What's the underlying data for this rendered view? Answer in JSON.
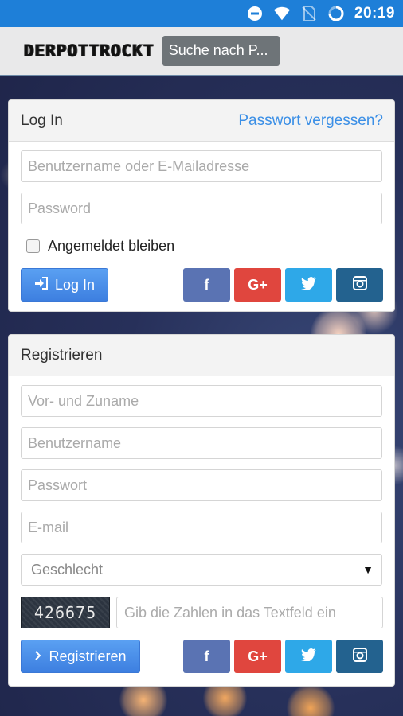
{
  "status_bar": {
    "time": "20:19",
    "icons": [
      "do-not-disturb-icon",
      "wifi-icon",
      "no-sim-icon",
      "loading-icon"
    ]
  },
  "app_bar": {
    "logo": "DERPOTTROCKT",
    "search_label": "Suche nach P..."
  },
  "login": {
    "title": "Log In",
    "forgot_link": "Passwort vergessen?",
    "username_placeholder": "Benutzername oder E-Mailadresse",
    "password_placeholder": "Password",
    "remember_label": "Angemeldet bleiben",
    "submit_label": "Log In",
    "submit_icon": "sign-in-icon"
  },
  "register": {
    "title": "Registrieren",
    "fullname_placeholder": "Vor- und Zuname",
    "username_placeholder": "Benutzername",
    "password_placeholder": "Passwort",
    "email_placeholder": "E-mail",
    "gender_selected": "Geschlecht",
    "captcha_code": "426675",
    "captcha_placeholder": "Gib die Zahlen in das Textfeld ein",
    "submit_label": "Registrieren",
    "submit_icon": "chevron-right-icon"
  },
  "social": {
    "facebook": "f",
    "googleplus": "G+",
    "colors": {
      "facebook": "#5a73b3",
      "googleplus": "#e0463e",
      "twitter": "#2ea8e8",
      "instagram": "#23628f"
    }
  },
  "colors": {
    "status_bar": "#1e7fd8",
    "accent_link": "#3b8fe6",
    "primary_button": "#4a8fe8"
  }
}
